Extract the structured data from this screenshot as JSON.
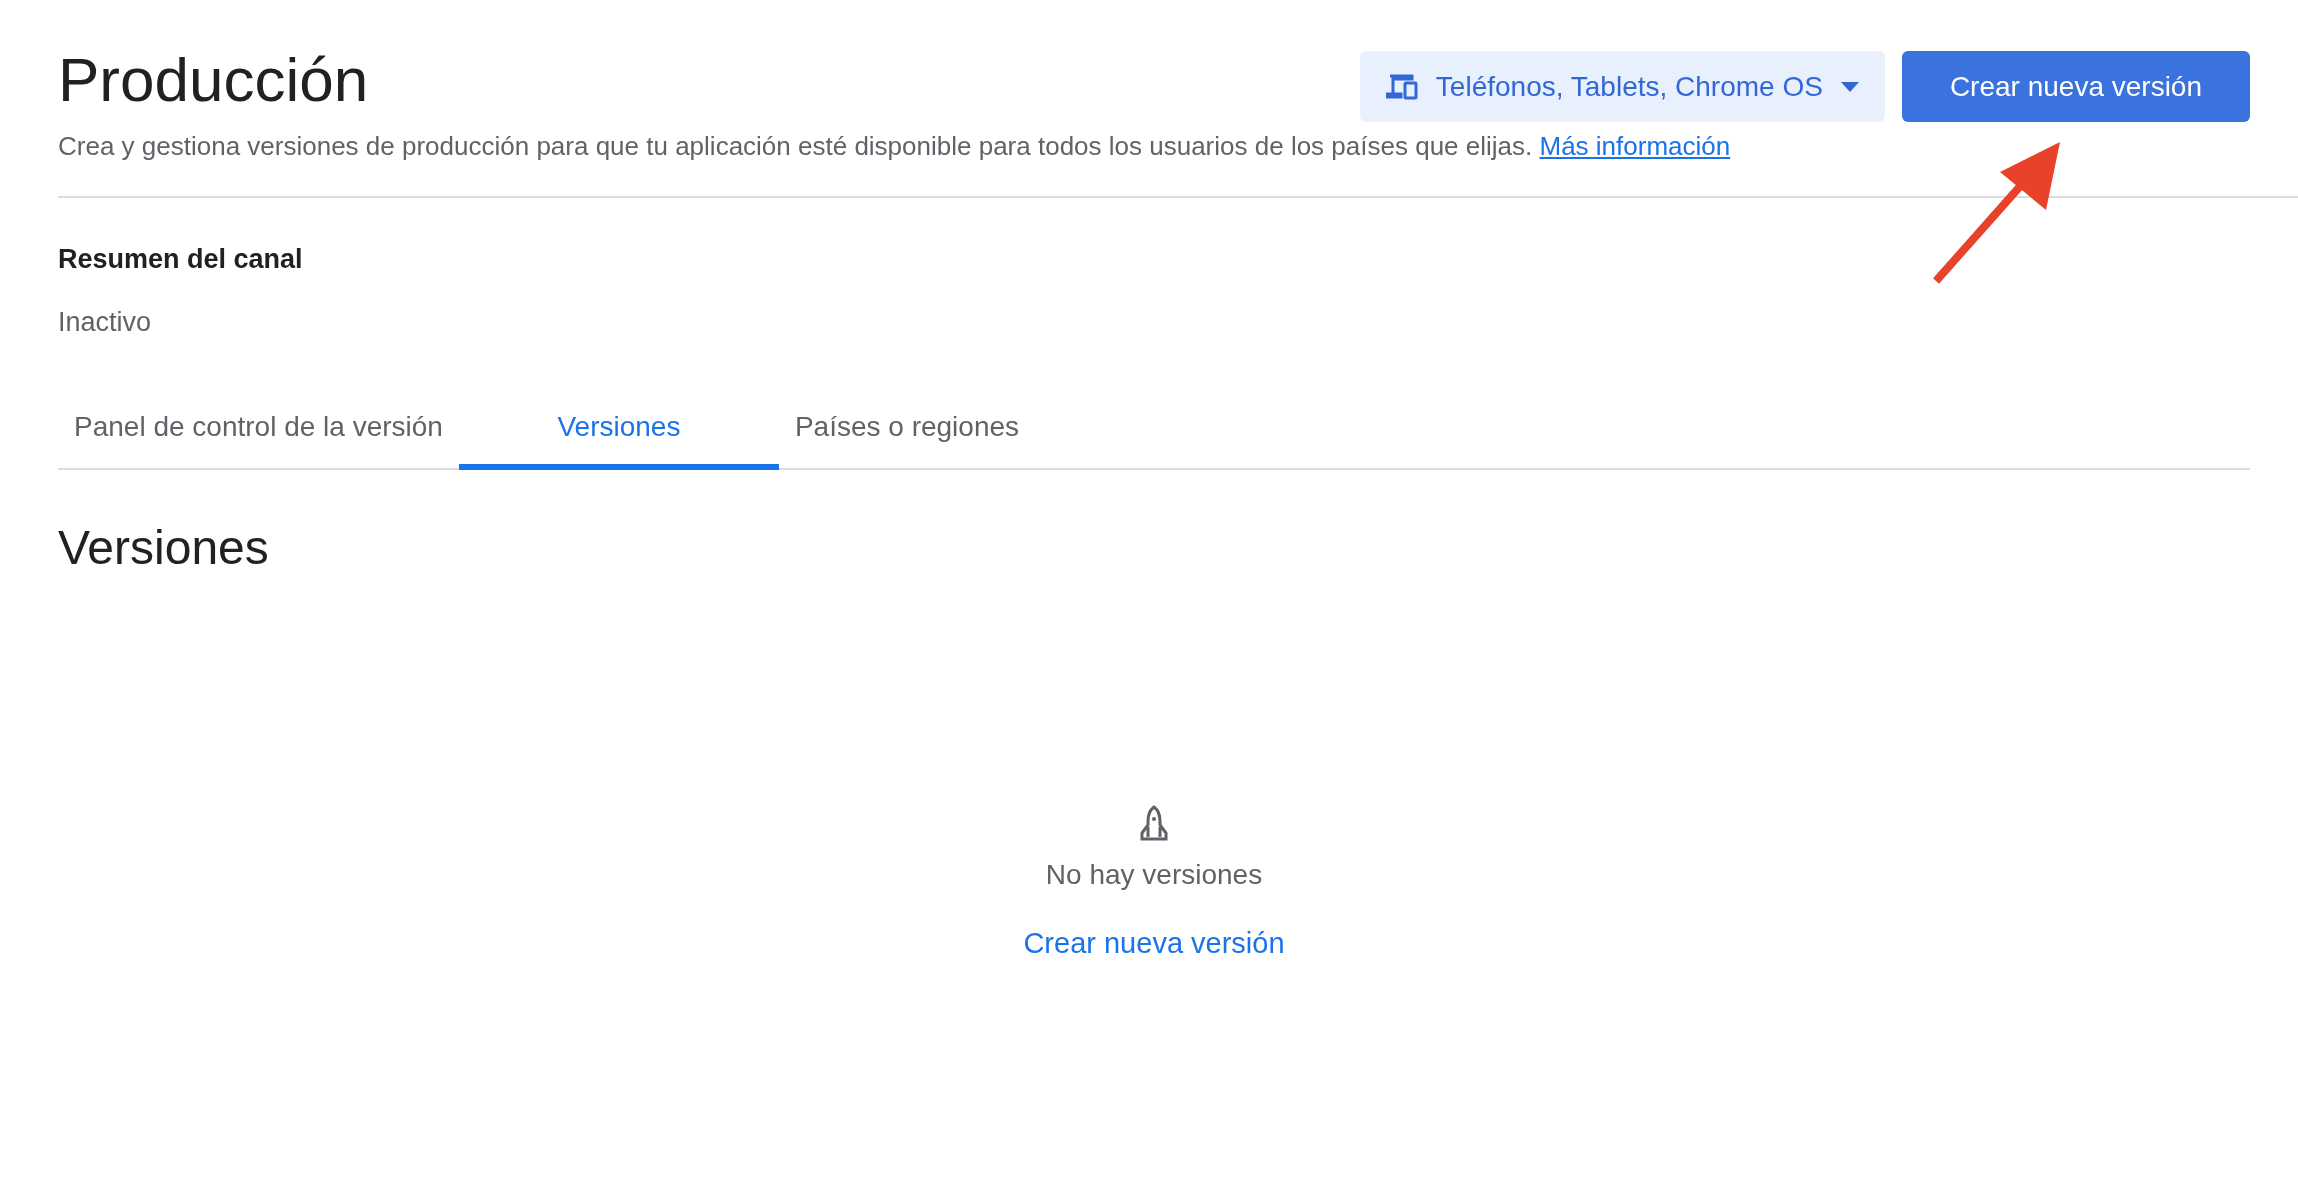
{
  "header": {
    "title": "Producción",
    "description": "Crea y gestiona versiones de producción para que tu aplicación esté disponible para todos los usuarios de los países que elijas.",
    "learn_more_link": "Más información",
    "device_selector": "Teléfonos, Tablets, Chrome OS",
    "create_button": "Crear nueva versión"
  },
  "channel_summary": {
    "heading": "Resumen del canal",
    "status": "Inactivo"
  },
  "tabs": [
    {
      "label": "Panel de control de la versión",
      "selected": false
    },
    {
      "label": "Versiones",
      "selected": true
    },
    {
      "label": "Países o regiones",
      "selected": false
    }
  ],
  "section": {
    "heading": "Versiones",
    "empty_message": "No hay versiones",
    "create_link": "Crear nueva versión"
  }
}
